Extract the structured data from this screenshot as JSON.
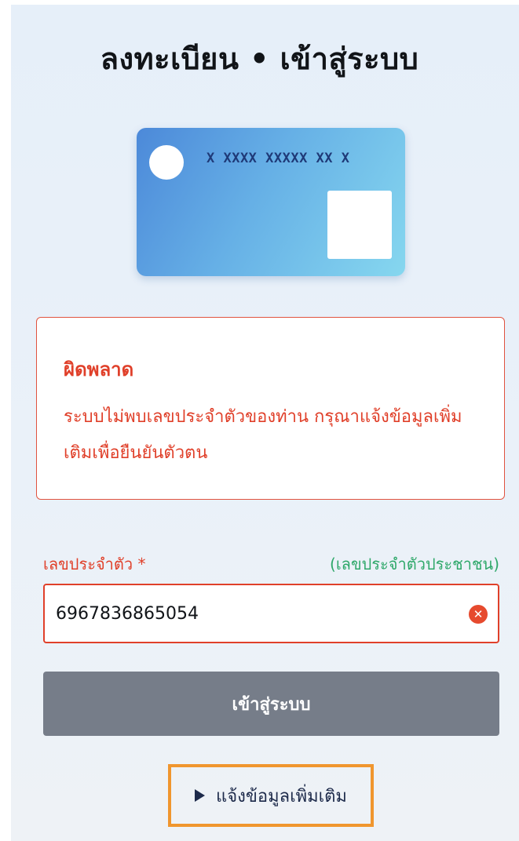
{
  "header": {
    "title": "ลงทะเบียน • เข้าสู่ระบบ"
  },
  "id_card": {
    "number_mask": "X XXXX XXXXX XX X"
  },
  "error": {
    "title": "ผิดพลาด",
    "message": "ระบบไม่พบเลขประจำตัวของท่าน กรุณาแจ้งข้อมูลเพิ่มเติมเพื่อยืนยันตัวตน"
  },
  "form": {
    "id_label": "เลขประจำตัว *",
    "id_hint": "(เลขประจำตัวประชาชน)",
    "id_value": "6967836865054",
    "clear_icon": "clear-icon"
  },
  "actions": {
    "login_label": "เข้าสู่ระบบ",
    "more_info_label": "แจ้งข้อมูลเพิ่มเติม",
    "more_info_icon": "play-icon"
  },
  "colors": {
    "error": "#e0402a",
    "hint": "#2fa86a",
    "button": "#767d89",
    "highlight": "#f0962e"
  }
}
